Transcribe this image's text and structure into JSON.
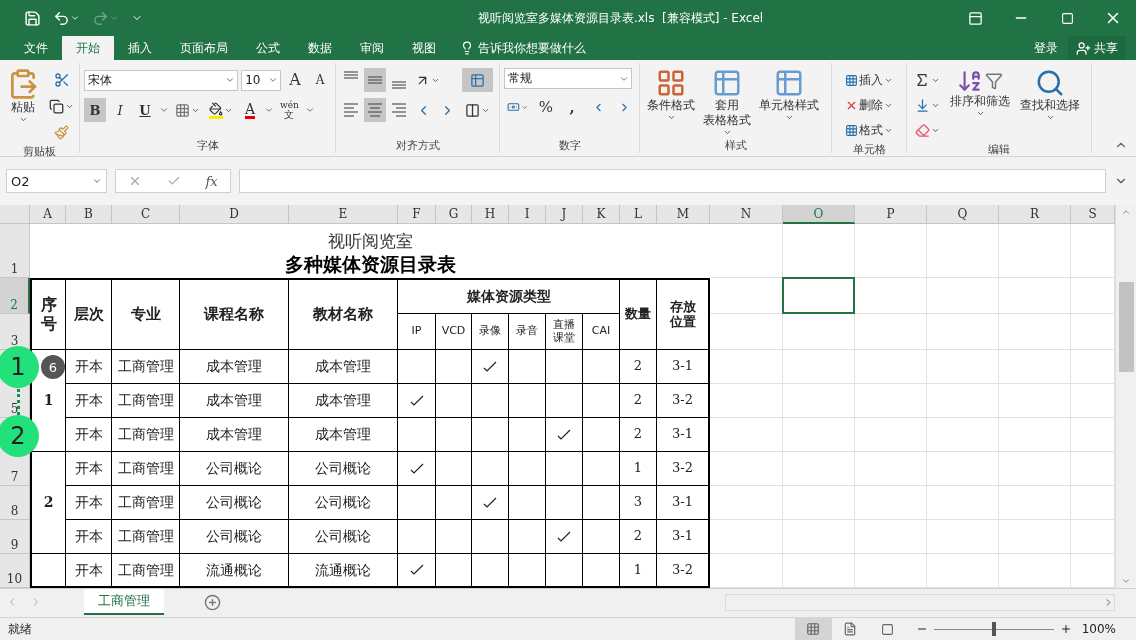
{
  "window": {
    "title": "视听阅览室多媒体资源目录表.xls  [兼容模式] - Excel"
  },
  "ribbon_tabs": [
    {
      "label": "文件",
      "selected": false
    },
    {
      "label": "开始",
      "selected": true
    },
    {
      "label": "插入",
      "selected": false
    },
    {
      "label": "页面布局",
      "selected": false
    },
    {
      "label": "公式",
      "selected": false
    },
    {
      "label": "数据",
      "selected": false
    },
    {
      "label": "审阅",
      "selected": false
    },
    {
      "label": "视图",
      "selected": false
    }
  ],
  "tell_me": "告诉我你想要做什么",
  "account": {
    "sign_in": "登录",
    "share": "共享"
  },
  "clipboard": {
    "paste": "粘贴",
    "label": "剪贴板"
  },
  "font": {
    "name": "宋体",
    "size": "10",
    "grow": "A",
    "shrink": "A",
    "bold": "B",
    "bold_on": true,
    "italic": "I",
    "underline": "U",
    "font_color": "A",
    "phonetic": "wén",
    "phonetic_char": "文",
    "label": "字体"
  },
  "alignment": {
    "vertical": [
      {
        "selected": false
      },
      {
        "selected": true
      },
      {
        "selected": false
      }
    ],
    "horizontal": [
      {
        "selected": false
      },
      {
        "selected": true
      },
      {
        "selected": false
      }
    ],
    "wrap_text_on": true,
    "label": "对齐方式"
  },
  "number": {
    "format": "常规",
    "percent": "%",
    "comma": ",",
    "label": "数字"
  },
  "styles": {
    "buttons": [
      {
        "lines": [
          "条件格式"
        ]
      },
      {
        "lines": [
          "套用",
          "表格格式"
        ]
      },
      {
        "lines": [
          "单元格样式"
        ]
      }
    ],
    "label": "样式"
  },
  "cells": {
    "buttons": [
      "插入",
      "删除",
      "格式"
    ],
    "label": "单元格"
  },
  "editing": {
    "buttons": [
      "排序和筛选",
      "查找和选择"
    ],
    "label": "编辑"
  },
  "formula_bar": {
    "name_box": "O2",
    "fx": "fx"
  },
  "sheet": {
    "columns": [
      {
        "label": "A",
        "selected": false
      },
      {
        "label": "B",
        "selected": false
      },
      {
        "label": "C",
        "selected": false
      },
      {
        "label": "D",
        "selected": false
      },
      {
        "label": "E",
        "selected": false
      },
      {
        "label": "F",
        "selected": false
      },
      {
        "label": "G",
        "selected": false
      },
      {
        "label": "H",
        "selected": false
      },
      {
        "label": "I",
        "selected": false
      },
      {
        "label": "J",
        "selected": false
      },
      {
        "label": "K",
        "selected": false
      },
      {
        "label": "L",
        "selected": false
      },
      {
        "label": "M",
        "selected": false
      },
      {
        "label": "N",
        "selected": false
      },
      {
        "label": "O",
        "selected": true
      },
      {
        "label": "P",
        "selected": false
      },
      {
        "label": "Q",
        "selected": false
      },
      {
        "label": "R",
        "selected": false
      },
      {
        "label": "S",
        "selected": false
      }
    ],
    "rows": [
      {
        "label": "1",
        "selected": false
      },
      {
        "label": "2",
        "selected": true
      },
      {
        "label": "3",
        "selected": false
      },
      {
        "selected": false,
        "covered": true
      },
      {
        "label": "5",
        "selected": false
      },
      {
        "selected": false,
        "covered": true
      },
      {
        "label": "7",
        "selected": false
      },
      {
        "label": "8",
        "selected": false
      },
      {
        "label": "9",
        "selected": false
      },
      {
        "label": "10",
        "selected": false
      }
    ],
    "title": "视听阅览室",
    "subtitle": "多种媒体资源目录表",
    "headers": [
      "序号",
      "层次",
      "专业",
      "课程名称",
      "教材名称"
    ],
    "media_header": "媒体资源类型",
    "media_types": [
      "IP",
      "VCD",
      "录像",
      "录音",
      "直播课堂",
      "CAI"
    ],
    "count_header": "数量",
    "location_header": "存放位置",
    "groups": [
      {
        "seq": "1",
        "rows": [
          {
            "tier": "开本",
            "major": "工商管理",
            "course": "成本管理",
            "textbook": "成本管理",
            "media_checks": [
              false,
              false,
              true,
              false,
              false,
              false
            ],
            "count": "2",
            "location": "3-1"
          },
          {
            "tier": "开本",
            "major": "工商管理",
            "course": "成本管理",
            "textbook": "成本管理",
            "media_checks": [
              true,
              false,
              false,
              false,
              false,
              false
            ],
            "count": "2",
            "location": "3-2"
          },
          {
            "tier": "开本",
            "major": "工商管理",
            "course": "成本管理",
            "textbook": "成本管理",
            "media_checks": [
              false,
              false,
              false,
              false,
              true,
              false
            ],
            "count": "2",
            "location": "3-1"
          }
        ]
      },
      {
        "seq": "2",
        "rows": [
          {
            "tier": "开本",
            "major": "工商管理",
            "course": "公司概论",
            "textbook": "公司概论",
            "media_checks": [
              true,
              false,
              false,
              false,
              false,
              false
            ],
            "count": "1",
            "location": "3-2"
          },
          {
            "tier": "开本",
            "major": "工商管理",
            "course": "公司概论",
            "textbook": "公司概论",
            "media_checks": [
              false,
              false,
              true,
              false,
              false,
              false
            ],
            "count": "3",
            "location": "3-1"
          },
          {
            "tier": "开本",
            "major": "工商管理",
            "course": "公司概论",
            "textbook": "公司概论",
            "media_checks": [
              false,
              false,
              false,
              false,
              true,
              false
            ],
            "count": "2",
            "location": "3-1"
          }
        ]
      },
      {
        "rows": [
          {
            "tier": "开本",
            "major": "工商管理",
            "course": "流通概论",
            "textbook": "流通概论",
            "media_checks": [
              true,
              false,
              false,
              false,
              false,
              false
            ],
            "count": "1",
            "location": "3-2"
          }
        ]
      }
    ]
  },
  "step_markers": [
    {
      "label": "1"
    },
    {
      "label": "2"
    }
  ],
  "badge": "6",
  "sheet_tabs": [
    {
      "label": "工商管理",
      "selected": true
    }
  ],
  "status_bar": {
    "text": "就绪",
    "views": [
      {
        "selected": true
      },
      {
        "selected": false
      },
      {
        "selected": false
      }
    ],
    "zoom_slider": {
      "level": 0.5
    },
    "zoom": "100%"
  }
}
